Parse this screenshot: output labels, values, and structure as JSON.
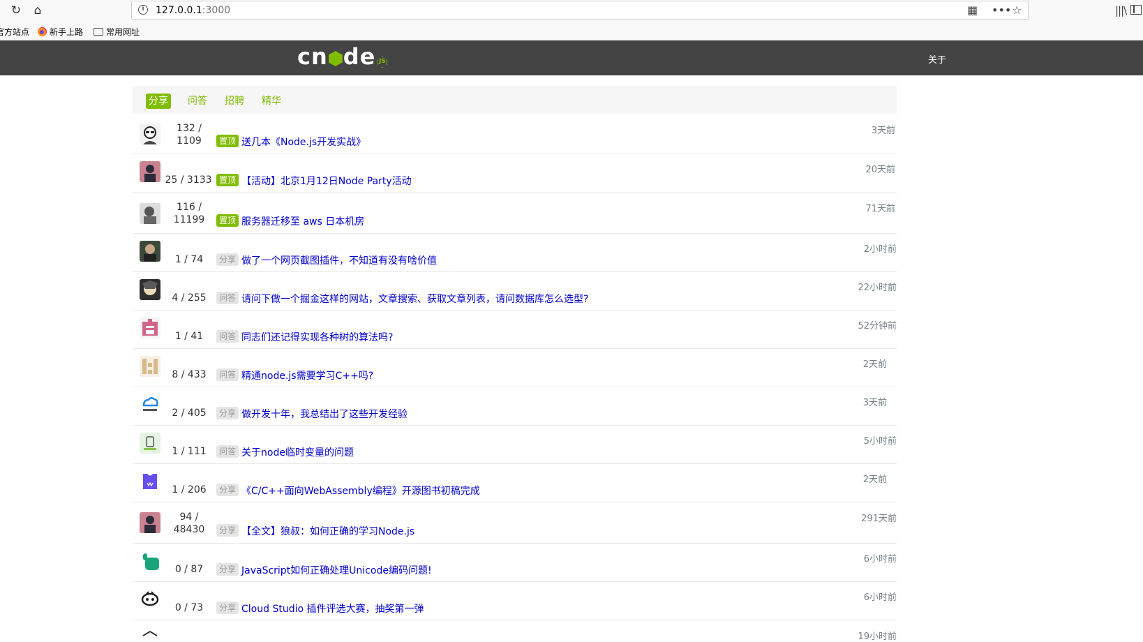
{
  "browser": {
    "url_host": "127.0.0.1",
    "url_port": ":3000",
    "bookmarks": [
      "官方站点",
      "新手上路",
      "常用网址"
    ]
  },
  "site": {
    "logo_before": "cn",
    "logo_after": "de",
    "logo_badge": "JS",
    "nav_about": "关于"
  },
  "tabs": [
    "分享",
    "问答",
    "招聘",
    "精华"
  ],
  "topics": [
    {
      "replies": "132",
      "visits": "1109",
      "tag": "置顶",
      "title": "送几本《Node.js开发实战》",
      "time": "3天前"
    },
    {
      "replies": "25",
      "visits": "3133",
      "tag": "置顶",
      "title": "【活动】北京1月12日Node Party活动",
      "time": "20天前"
    },
    {
      "replies": "116",
      "visits": "11199",
      "tag": "置顶",
      "title": "服务器迁移至 aws 日本机房",
      "time": "71天前"
    },
    {
      "replies": "1",
      "visits": "74",
      "tag": "分享",
      "title": "做了一个网页截图插件，不知道有没有啥价值",
      "time": "2小时前"
    },
    {
      "replies": "4",
      "visits": "255",
      "tag": "问答",
      "title": "请问下做一个掘金这样的网站，文章搜索、获取文章列表，请问数据库怎么选型?",
      "time": "22小时前"
    },
    {
      "replies": "1",
      "visits": "41",
      "tag": "问答",
      "title": "同志们还记得实现各种树的算法吗?",
      "time": "52分钟前"
    },
    {
      "replies": "8",
      "visits": "433",
      "tag": "问答",
      "title": "精通node.js需要学习C++吗?",
      "time": "2天前"
    },
    {
      "replies": "2",
      "visits": "405",
      "tag": "分享",
      "title": "做开发十年，我总结出了这些开发经验",
      "time": "3天前"
    },
    {
      "replies": "1",
      "visits": "111",
      "tag": "问答",
      "title": "关于node临时变量的问题",
      "time": "5小时前"
    },
    {
      "replies": "1",
      "visits": "206",
      "tag": "分享",
      "title": "《C/C++面向WebAssembly编程》开源图书初稿完成",
      "time": "2天前"
    },
    {
      "replies": "94",
      "visits": "48430",
      "tag": "分享",
      "title": "【全文】狼叔：如何正确的学习Node.js",
      "time": "291天前"
    },
    {
      "replies": "0",
      "visits": "87",
      "tag": "分享",
      "title": "JavaScript如何正确处理Unicode编码问题!",
      "time": "6小时前"
    },
    {
      "replies": "0",
      "visits": "73",
      "tag": "分享",
      "title": "Cloud Studio 插件评选大赛，抽奖第一弹",
      "time": "6小时前"
    },
    {
      "replies": "",
      "visits": "",
      "tag": "",
      "title": "",
      "time": "19小时前"
    }
  ],
  "colors": {
    "accent": "#80bd01",
    "navbar": "#444444",
    "link": "#0000cc",
    "time": "#778087"
  }
}
